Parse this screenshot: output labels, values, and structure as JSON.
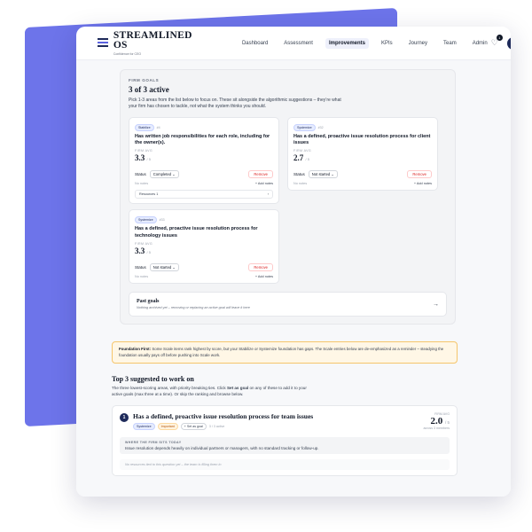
{
  "brand": {
    "name": "STREAMLINED OS",
    "tagline": "Confidence for CEO"
  },
  "nav": {
    "items": [
      "Dashboard",
      "Assessment",
      "Improvements",
      "KPIs",
      "Journey",
      "Team",
      "Admin"
    ],
    "active": "Improvements"
  },
  "header": {
    "notification_count": "1",
    "avatar_initial": "B"
  },
  "firm_goals": {
    "eyebrow": "FIRM GOALS",
    "title": "3 of 3 active",
    "description": "Pick 1-3 areas from the list below to focus on. These sit alongside the algorithmic suggestions – they’re what your firm has chosen to tackle, not what the system thinks you should.",
    "cards": [
      {
        "tag": "Stabilize",
        "qnum": "#4",
        "title": "Has written job responsibilities for each role, including for the owner(s).",
        "avg_label": "FIRM AVG",
        "score": "3.3",
        "score_max": "/ 5",
        "status_label": "Status",
        "status_value": "Completed",
        "remove_label": "Remove",
        "notes": "No notes",
        "add_notes": "+ Add notes",
        "resources": "Resources 1",
        "resources_arrow": "›"
      },
      {
        "tag": "Systemize",
        "qnum": "#32",
        "title": "Has a defined, proactive issue resolution process for client issues",
        "avg_label": "FIRM AVG",
        "score": "2.7",
        "score_max": "/ 5",
        "status_label": "Status",
        "status_value": "Not started",
        "remove_label": "Remove",
        "notes": "No notes",
        "add_notes": "+ Add notes"
      },
      {
        "tag": "Systemize",
        "qnum": "#33",
        "title": "Has a defined, proactive issue resolution process for technology issues",
        "avg_label": "FIRM AVG",
        "score": "3.3",
        "score_max": "/ 5",
        "status_label": "Status",
        "status_value": "Not started",
        "remove_label": "Remove",
        "notes": "No notes",
        "add_notes": "+ Add notes"
      }
    ],
    "past": {
      "title": "Past goals",
      "desc": "Nothing archived yet – removing or replacing an active goal will leave it here",
      "arrow": "→"
    }
  },
  "banner": {
    "strong": "Foundation First:",
    "text": " Some Scale items rank highest by score, but your Stabilize or Systemize foundation has gaps. The Scale entries below are de-emphasized as a reminder – steadying the foundation usually pays off before pushing into Scale work."
  },
  "top3": {
    "title": "Top 3 suggested to work on",
    "desc_a": "The three lowest-scoring areas, with priority breaking ties. Click ",
    "desc_bold": "Set as goal",
    "desc_b": " on any of these to add it to your active goals (max three at a time). Or skip the ranking and browse below."
  },
  "suggestion": {
    "rank": "1",
    "title": "Has a defined, proactive issue resolution process for team issues",
    "tag": "Systemize",
    "importance": "Important",
    "set_goal": "+ Set as goal",
    "active_count": "3 / 3 active",
    "avg_label": "FIRM AVG",
    "score": "2.0",
    "score_max": "/ 5",
    "members": "across 3 members",
    "where_label": "WHERE THE FIRM SITS TODAY",
    "where_text": "Issue resolution depends heavily on individual partners or managers, with no standard tracking or follow-up.",
    "no_resources": "No resources tied to this question yet – the team is filling them in"
  }
}
